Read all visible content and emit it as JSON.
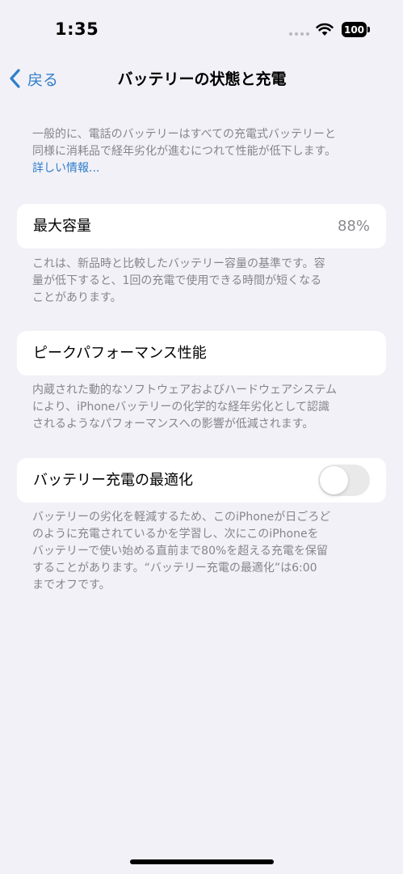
{
  "status_bar": {
    "time": "1:35",
    "battery_level": "100",
    "signal_icon": "cellular-dots-icon",
    "wifi_icon": "wifi-icon"
  },
  "nav": {
    "back_label": "戻る",
    "back_icon": "chevron-left-icon",
    "title": "バッテリーの状態と充電"
  },
  "intro": {
    "line1": "一般的に、電話のバッテリーはすべての充電式バッテリーと",
    "line2": "同様に消耗品で経年劣化が進むにつれて性能が低下します。",
    "link": "詳しい情報..."
  },
  "max_capacity": {
    "label": "最大容量",
    "value": "88%",
    "desc_line1": "これは、新品時と比較したバッテリー容量の基準です。容",
    "desc_line2": "量が低下すると、1回の充電で使用できる時間が短くなる",
    "desc_line3": "ことがあります。"
  },
  "peak_performance": {
    "label": "ピークパフォーマンス性能",
    "desc_line1": "内蔵された動的なソフトウェアおよびハードウェアシステム",
    "desc_line2": "により、iPhoneバッテリーの化学的な経年劣化として認識",
    "desc_line3": "されるようなパフォーマンスへの影響が低減されます。"
  },
  "optimized_charging": {
    "label": "バッテリー充電の最適化",
    "enabled": false,
    "desc_line1": "バッテリーの劣化を軽減するため、このiPhoneが日ごろど",
    "desc_line2": "のように充電されているかを学習し、次にこのiPhoneを",
    "desc_line3": "バッテリーで使い始める直前まで80%を超える充電を保留",
    "desc_line4": "することがあります。“バッテリー充電の最適化”は6:00",
    "desc_line5": "までオフです。"
  },
  "colors": {
    "background": "#f2f1f7",
    "accent": "#2f7ecb",
    "secondary_text": "#86858b",
    "toggle_off": "#e9e9ea"
  }
}
